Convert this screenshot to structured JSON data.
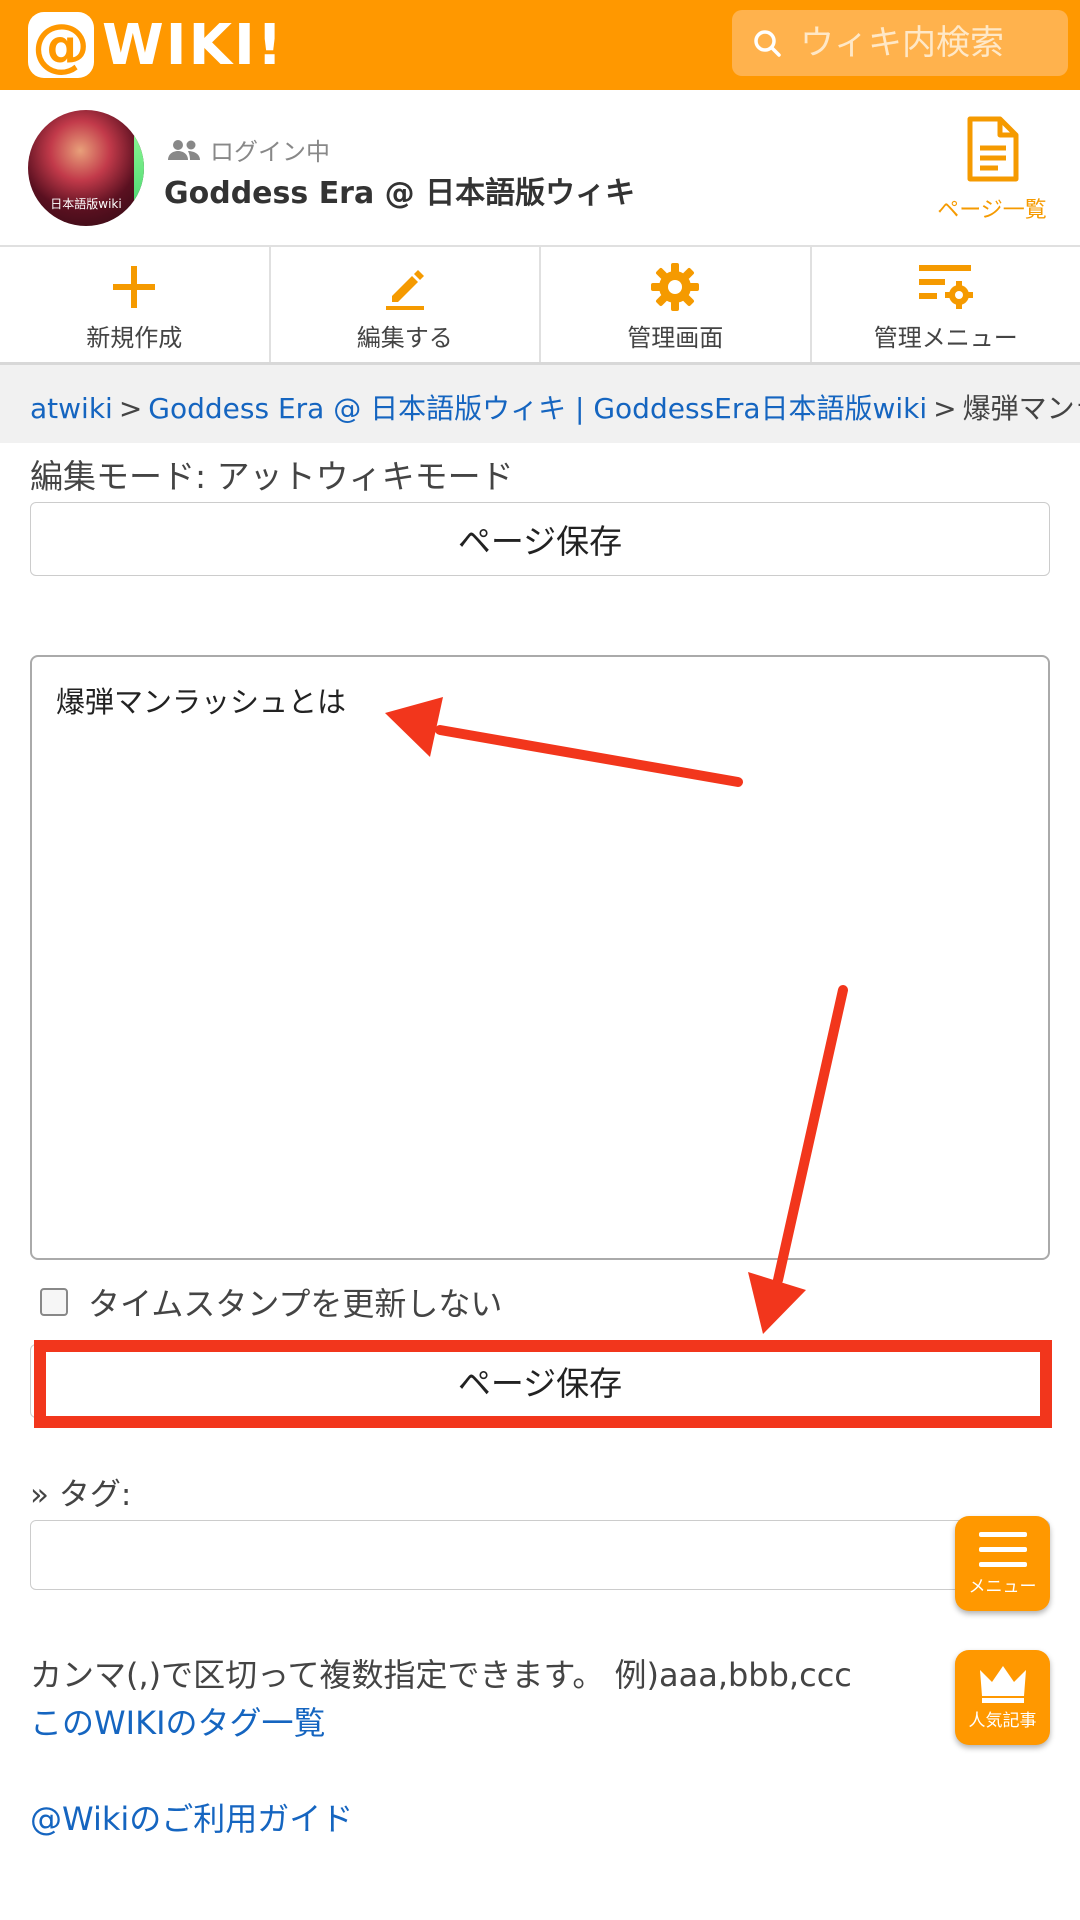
{
  "header": {
    "logo_at": "@",
    "logo_text": "WIKI!",
    "search_placeholder": "ウィキ内検索"
  },
  "site": {
    "avatar_caption": "日本語版wiki",
    "login_status": "ログイン中",
    "name": "Goddess Era @ 日本語版ウィキ",
    "page_list_label": "ページ一覧"
  },
  "actions": [
    {
      "label": "新規作成",
      "icon": "plus-icon"
    },
    {
      "label": "編集する",
      "icon": "pencil-icon"
    },
    {
      "label": "管理画面",
      "icon": "gear-icon"
    },
    {
      "label": "管理メニュー",
      "icon": "settings-list-icon"
    }
  ],
  "breadcrumb": {
    "items": [
      "atwiki",
      "Goddess Era @ 日本語版ウィキ | GoddessEra日本語版wiki",
      "爆弾マンラッシュ"
    ],
    "separator": ">"
  },
  "editor": {
    "mode_label": "編集モード: アットウィキモード",
    "save_label": "ページ保存",
    "content": "爆弾マンラッシュとは",
    "timestamp_label": "タイムスタンプを更新しない",
    "timestamp_checked": false
  },
  "tags": {
    "label": "» タグ:",
    "value": "",
    "help": "カンマ(,)で区切って複数指定できます。 例)aaa,bbb,ccc",
    "list_link": "このWIKIのタグ一覧"
  },
  "footer": {
    "guide_link": "@Wikiのご利用ガイド"
  },
  "floating": {
    "menu_label": "メニュー",
    "popular_label": "人気記事"
  },
  "colors": {
    "brand": "#ff9800",
    "link": "#1565c0",
    "annotation": "#f2361c"
  }
}
